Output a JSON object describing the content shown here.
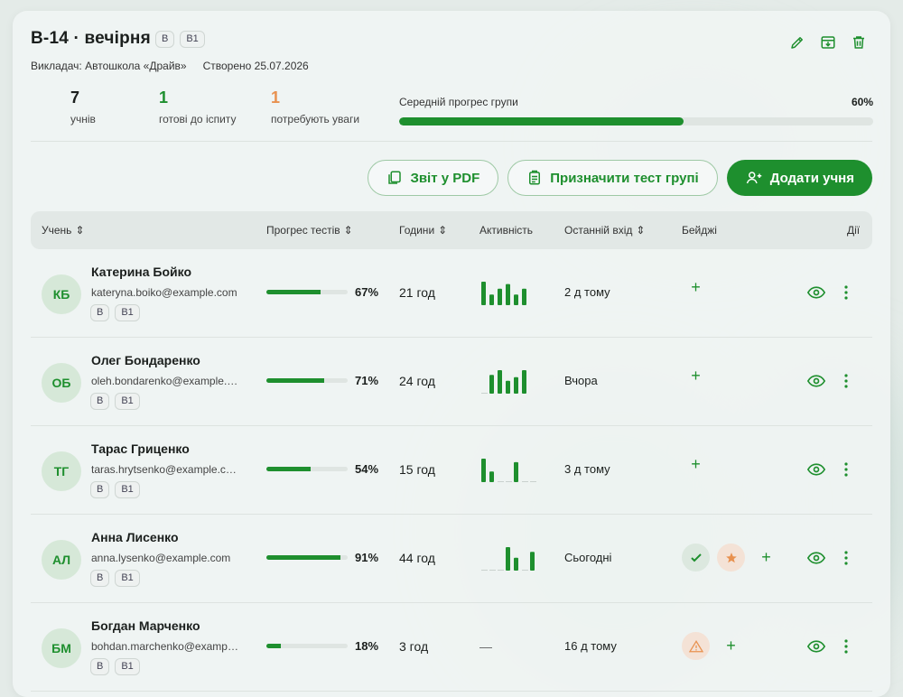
{
  "group": {
    "title": "В-14 · вечірня",
    "chips": [
      "B",
      "B1"
    ],
    "teacher": "Викладач: Автошкола «Драйв»",
    "created": "Створено 25.07.2026"
  },
  "stats": [
    {
      "num": "7",
      "label": "учнів",
      "color": "#1b1f1d"
    },
    {
      "num": "1",
      "label": "готові до іспиту",
      "color": "#1e8f2e"
    },
    {
      "num": "1",
      "label": "потребують уваги",
      "color": "#e8914f"
    }
  ],
  "avg_progress": {
    "label": "Середній прогрес групи",
    "value_text": "60%",
    "value": 60
  },
  "actions": {
    "pdf": "Звіт у PDF",
    "assign": "Призначити тест групі",
    "add": "Додати учня"
  },
  "table": {
    "headers": {
      "student": "Учень",
      "progress": "Прогрес тестів",
      "hours": "Години",
      "activity": "Активність",
      "last": "Останній вхід",
      "badges": "Бейджі",
      "actions": "Дії"
    },
    "rows": [
      {
        "initials": "КБ",
        "name": "Катерина Бойко",
        "email": "kateryna.boiko@example.com",
        "chips": [
          "B",
          "B1"
        ],
        "progress": 67,
        "progress_text": "67%",
        "hours": "21 год",
        "activity": [
          1.0,
          0.45,
          0.7,
          0.9,
          0.45,
          0.7
        ],
        "last": "2 д тому",
        "badges": []
      },
      {
        "initials": "ОБ",
        "name": "Олег Бондаренко",
        "email": "oleh.bondarenko@example.com",
        "chips": [
          "B",
          "B1"
        ],
        "progress": 71,
        "progress_text": "71%",
        "hours": "24 год",
        "activity": [
          0,
          0.8,
          1.0,
          0.55,
          0.7,
          1.0
        ],
        "last": "Вчора",
        "badges": []
      },
      {
        "initials": "ТГ",
        "name": "Тарас Гриценко",
        "email": "taras.hrytsenko@example.com",
        "chips": [
          "B",
          "B1"
        ],
        "progress": 54,
        "progress_text": "54%",
        "hours": "15 год",
        "activity": [
          1.0,
          0.45,
          0,
          0,
          0.85,
          0,
          0
        ],
        "last": "3 д тому",
        "badges": []
      },
      {
        "initials": "АЛ",
        "name": "Анна Лисенко",
        "email": "anna.lysenko@example.com",
        "chips": [
          "B",
          "B1"
        ],
        "progress": 91,
        "progress_text": "91%",
        "hours": "44 год",
        "activity": [
          0,
          0,
          0,
          1.0,
          0.55,
          0,
          0.8
        ],
        "last": "Сьогодні",
        "badges": [
          "check",
          "star"
        ]
      },
      {
        "initials": "БМ",
        "name": "Богдан Марченко",
        "email": "bohdan.marchenko@example.com",
        "chips": [
          "B",
          "B1"
        ],
        "progress": 18,
        "progress_text": "18%",
        "hours": "3 год",
        "activity_text": "—",
        "last": "16 д тому",
        "badges": [
          "warning"
        ]
      }
    ]
  },
  "colors": {
    "accent": "#1e8f2e",
    "warning": "#e8914f"
  }
}
